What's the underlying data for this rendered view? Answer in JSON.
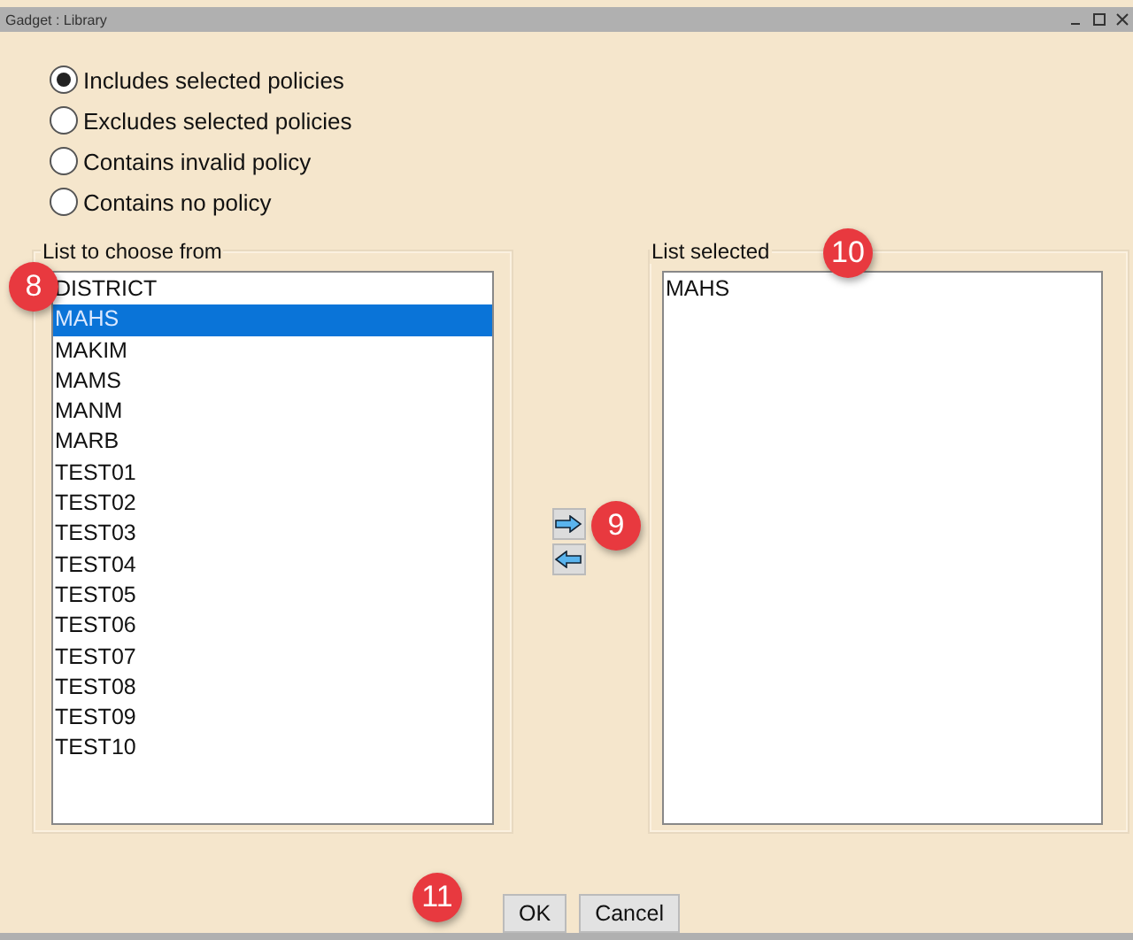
{
  "window": {
    "title": "Gadget : Library"
  },
  "options": [
    {
      "label": "Includes selected policies",
      "selected": true
    },
    {
      "label": "Excludes selected policies",
      "selected": false
    },
    {
      "label": "Contains invalid policy",
      "selected": false
    },
    {
      "label": "Contains no policy",
      "selected": false
    }
  ],
  "choose_list": {
    "title": "List to choose from",
    "items": [
      {
        "label": "DISTRICT",
        "selected": false
      },
      {
        "label": "MAHS",
        "selected": true
      },
      {
        "label": "MAKIM",
        "selected": false
      },
      {
        "label": "MAMS",
        "selected": false
      },
      {
        "label": "MANM",
        "selected": false
      },
      {
        "label": "MARB",
        "selected": false
      },
      {
        "label": "TEST01",
        "selected": false
      },
      {
        "label": "TEST02",
        "selected": false
      },
      {
        "label": "TEST03",
        "selected": false
      },
      {
        "label": "TEST04",
        "selected": false
      },
      {
        "label": "TEST05",
        "selected": false
      },
      {
        "label": "TEST06",
        "selected": false
      },
      {
        "label": "TEST07",
        "selected": false
      },
      {
        "label": "TEST08",
        "selected": false
      },
      {
        "label": "TEST09",
        "selected": false
      },
      {
        "label": "TEST10",
        "selected": false
      }
    ]
  },
  "selected_list": {
    "title": "List selected",
    "items": [
      {
        "label": "MAHS",
        "selected": false
      }
    ]
  },
  "callouts": [
    "8",
    "9",
    "10",
    "11"
  ],
  "buttons": [
    "OK",
    "Cancel"
  ]
}
